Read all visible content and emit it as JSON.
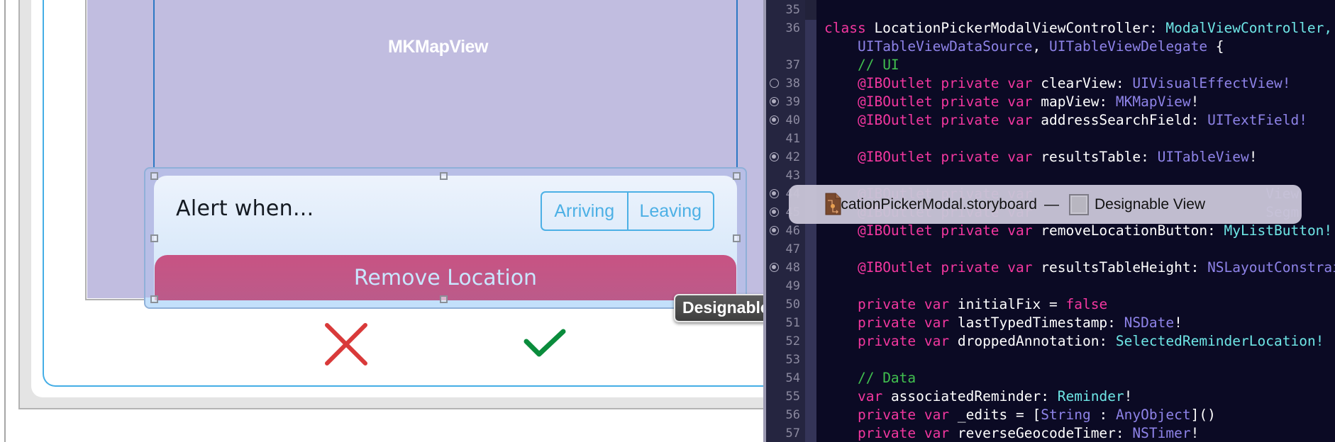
{
  "canvas": {
    "map_view_label": "MKMapView",
    "designable_view": {
      "alert_label": "Alert when...",
      "segmented_control": {
        "segments": [
          "Arriving",
          "Leaving"
        ]
      },
      "remove_button_label": "Remove Location"
    },
    "designable_tooltip": "Designable",
    "cancel_icon": "x-mark-icon",
    "confirm_icon": "checkmark-icon",
    "colors": {
      "map_bg": "#c1bde0",
      "remove_button": "#c85383",
      "segment_tint": "#4cb0e5",
      "cancel": "#d93a3a",
      "confirm": "#0a8c3c"
    }
  },
  "popup": {
    "file_name": "LocationPickerModal.storyboard",
    "separator": "—",
    "object_name": "Designable View"
  },
  "editor": {
    "lines": [
      {
        "number": "35",
        "outlet": "none",
        "segments": []
      },
      {
        "number": "36",
        "outlet": "none",
        "segments": [
          {
            "t": "kw",
            "v": "class"
          },
          {
            "t": "txt",
            "v": " LocationPickerModalViewController: "
          },
          {
            "t": "proj",
            "v": "ModalViewController,"
          }
        ]
      },
      {
        "number": "",
        "outlet": "none",
        "segments": [
          {
            "t": "txt",
            "v": "    "
          },
          {
            "t": "sys",
            "v": "UITableViewDataSource"
          },
          {
            "t": "txt",
            "v": ", "
          },
          {
            "t": "sys",
            "v": "UITableViewDelegate"
          },
          {
            "t": "txt",
            "v": " {"
          }
        ]
      },
      {
        "number": "37",
        "outlet": "none",
        "segments": [
          {
            "t": "txt",
            "v": "    "
          },
          {
            "t": "cmt",
            "v": "// UI"
          }
        ]
      },
      {
        "number": "38",
        "outlet": "empty",
        "segments": [
          {
            "t": "txt",
            "v": "    "
          },
          {
            "t": "kw",
            "v": "@IBOutlet private var"
          },
          {
            "t": "txt",
            "v": " clearView: "
          },
          {
            "t": "sys",
            "v": "UIVisualEffectView!"
          }
        ]
      },
      {
        "number": "39",
        "outlet": "filled",
        "segments": [
          {
            "t": "txt",
            "v": "    "
          },
          {
            "t": "kw",
            "v": "@IBOutlet private var"
          },
          {
            "t": "txt",
            "v": " mapView: "
          },
          {
            "t": "sys",
            "v": "MKMapView"
          },
          {
            "t": "txt",
            "v": "!"
          }
        ]
      },
      {
        "number": "40",
        "outlet": "filled",
        "segments": [
          {
            "t": "txt",
            "v": "    "
          },
          {
            "t": "kw",
            "v": "@IBOutlet private var"
          },
          {
            "t": "txt",
            "v": " addressSearchField: "
          },
          {
            "t": "sys",
            "v": "UITextField!"
          }
        ]
      },
      {
        "number": "41",
        "outlet": "none",
        "segments": []
      },
      {
        "number": "42",
        "outlet": "filled",
        "segments": [
          {
            "t": "txt",
            "v": "    "
          },
          {
            "t": "kw",
            "v": "@IBOutlet private var"
          },
          {
            "t": "txt",
            "v": " resultsTable: "
          },
          {
            "t": "sys",
            "v": "UITableView"
          },
          {
            "t": "txt",
            "v": "!"
          }
        ]
      },
      {
        "number": "43",
        "outlet": "none",
        "segments": []
      },
      {
        "number": "44",
        "outlet": "filled",
        "segments": [
          {
            "t": "txt",
            "v": "    "
          },
          {
            "t": "kw",
            "v": "@IBOutlet private var"
          },
          {
            "t": "txt",
            "v": "                            "
          },
          {
            "t": "sys",
            "v": "View"
          }
        ]
      },
      {
        "number": "45",
        "outlet": "filled",
        "segments": [
          {
            "t": "txt",
            "v": "    "
          },
          {
            "t": "kw",
            "v": "@IBOutlet private var"
          },
          {
            "t": "txt",
            "v": "                            "
          },
          {
            "t": "sys",
            "v": "Segm"
          }
        ]
      },
      {
        "number": "46",
        "outlet": "filled",
        "segments": [
          {
            "t": "txt",
            "v": "    "
          },
          {
            "t": "kw",
            "v": "@IBOutlet private var"
          },
          {
            "t": "txt",
            "v": " removeLocationButton: "
          },
          {
            "t": "proj",
            "v": "MyListButton!"
          }
        ]
      },
      {
        "number": "47",
        "outlet": "none",
        "segments": []
      },
      {
        "number": "48",
        "outlet": "filled",
        "segments": [
          {
            "t": "txt",
            "v": "    "
          },
          {
            "t": "kw",
            "v": "@IBOutlet private var"
          },
          {
            "t": "txt",
            "v": " resultsTableHeight: "
          },
          {
            "t": "sys",
            "v": "NSLayoutConstraint!"
          }
        ]
      },
      {
        "number": "49",
        "outlet": "none",
        "segments": []
      },
      {
        "number": "50",
        "outlet": "none",
        "segments": [
          {
            "t": "txt",
            "v": "    "
          },
          {
            "t": "kw",
            "v": "private var"
          },
          {
            "t": "txt",
            "v": " initialFix = "
          },
          {
            "t": "kw",
            "v": "false"
          }
        ]
      },
      {
        "number": "51",
        "outlet": "none",
        "segments": [
          {
            "t": "txt",
            "v": "    "
          },
          {
            "t": "kw",
            "v": "private var"
          },
          {
            "t": "txt",
            "v": " lastTypedTimestamp: "
          },
          {
            "t": "sys",
            "v": "NSDate"
          },
          {
            "t": "txt",
            "v": "!"
          }
        ]
      },
      {
        "number": "52",
        "outlet": "none",
        "segments": [
          {
            "t": "txt",
            "v": "    "
          },
          {
            "t": "kw",
            "v": "private var"
          },
          {
            "t": "txt",
            "v": " droppedAnnotation: "
          },
          {
            "t": "proj",
            "v": "SelectedReminderLocation!"
          }
        ]
      },
      {
        "number": "53",
        "outlet": "none",
        "segments": []
      },
      {
        "number": "54",
        "outlet": "none",
        "segments": [
          {
            "t": "txt",
            "v": "    "
          },
          {
            "t": "cmt",
            "v": "// Data"
          }
        ]
      },
      {
        "number": "55",
        "outlet": "none",
        "segments": [
          {
            "t": "txt",
            "v": "    "
          },
          {
            "t": "kw",
            "v": "var"
          },
          {
            "t": "txt",
            "v": " associatedReminder: "
          },
          {
            "t": "proj",
            "v": "Reminder"
          },
          {
            "t": "txt",
            "v": "!"
          }
        ]
      },
      {
        "number": "56",
        "outlet": "none",
        "segments": [
          {
            "t": "txt",
            "v": "    "
          },
          {
            "t": "kw",
            "v": "private var"
          },
          {
            "t": "txt",
            "v": " _edits = ["
          },
          {
            "t": "sys",
            "v": "String"
          },
          {
            "t": "txt",
            "v": " : "
          },
          {
            "t": "sys",
            "v": "AnyObject"
          },
          {
            "t": "txt",
            "v": "]()"
          }
        ]
      },
      {
        "number": "57",
        "outlet": "none",
        "segments": [
          {
            "t": "txt",
            "v": "    "
          },
          {
            "t": "kw",
            "v": "private var"
          },
          {
            "t": "txt",
            "v": " reverseGeocodeTimer: "
          },
          {
            "t": "sys",
            "v": "NSTimer"
          },
          {
            "t": "txt",
            "v": "!"
          }
        ]
      }
    ]
  }
}
